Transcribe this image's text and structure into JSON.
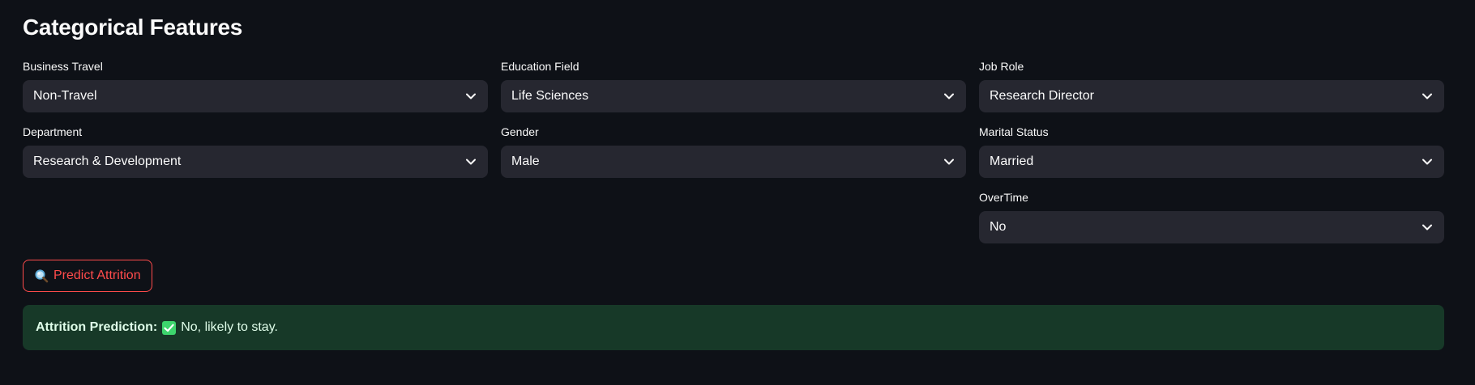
{
  "section": {
    "title": "Categorical Features"
  },
  "fields": {
    "business_travel": {
      "label": "Business Travel",
      "value": "Non-Travel"
    },
    "education_field": {
      "label": "Education Field",
      "value": "Life Sciences"
    },
    "job_role": {
      "label": "Job Role",
      "value": "Research Director"
    },
    "department": {
      "label": "Department",
      "value": "Research & Development"
    },
    "gender": {
      "label": "Gender",
      "value": "Male"
    },
    "marital_status": {
      "label": "Marital Status",
      "value": "Married"
    },
    "overtime": {
      "label": "OverTime",
      "value": "No"
    }
  },
  "predict_button": {
    "icon": "magnifying-glass-icon",
    "label": "Predict Attrition",
    "color": "#ff4b4b"
  },
  "result": {
    "label": "Attrition Prediction:",
    "icon": "check-mark-icon",
    "text": "No, likely to stay.",
    "background": "#173928",
    "icon_color": "#3dd56d"
  }
}
